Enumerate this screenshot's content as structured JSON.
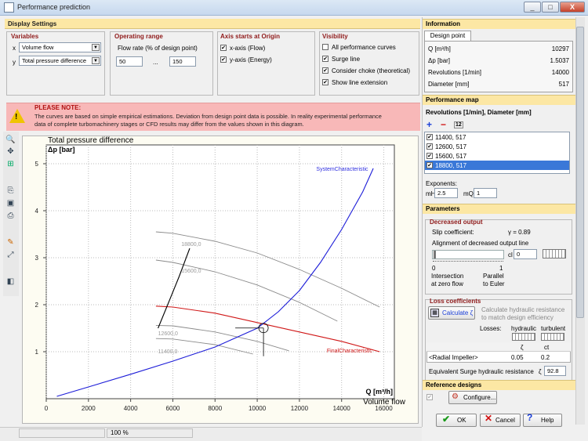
{
  "window": {
    "title": "Performance prediction",
    "min": "_",
    "max": "□",
    "close": "X"
  },
  "display_settings": {
    "header": "Display Settings",
    "variables": {
      "title": "Variables",
      "x_axis": "x",
      "x_value": "Volume flow",
      "y_axis": "y",
      "y_value": "Total pressure difference"
    },
    "operating_range": {
      "title": "Operating range",
      "label": "Flow rate (% of design point)",
      "min": "50",
      "sep": "...",
      "max": "150"
    },
    "axis_origin": {
      "title": "Axis starts at Origin",
      "x_label": "x-axis (Flow)",
      "y_label": "y-axis (Energy)"
    },
    "visibility": {
      "title": "Visibility",
      "items": [
        {
          "label": "All performance curves",
          "checked": false
        },
        {
          "label": "Surge line",
          "checked": true
        },
        {
          "label": "Consider choke (theoretical)",
          "checked": true
        },
        {
          "label": "Show line extension",
          "checked": true
        }
      ]
    }
  },
  "note": {
    "title": "PLEASE NOTE:",
    "line1": "The curves are based on simple empirical estimations. Deviation from design point data is possible. In reality experimental performance",
    "line2": "data of complete turbomachinery stages or CFD results may differ from the values shown in this diagram."
  },
  "chart_data": {
    "type": "line",
    "ylabel_line1": "Total pressure difference",
    "ylabel_line2": "Δp [bar]",
    "xlabel_line1": "Q [m³/h]",
    "xlabel_line2": "Volume flow",
    "xlim": [
      0,
      16500
    ],
    "ylim": [
      0,
      5.4
    ],
    "xticks": [
      0,
      2000,
      4000,
      6000,
      8000,
      10000,
      12000,
      14000,
      16000
    ],
    "yticks": [
      1,
      2,
      3,
      4,
      5
    ],
    "series": [
      {
        "name": "18800,0",
        "color": "#8a8a8a",
        "x": [
          5200,
          6000,
          8000,
          10000,
          12000,
          14000,
          15800
        ],
        "y": [
          3.55,
          3.52,
          3.35,
          3.1,
          2.75,
          2.35,
          1.95
        ]
      },
      {
        "name": "15600,0",
        "color": "#8a8a8a",
        "x": [
          5200,
          6000,
          8000,
          10000,
          12000,
          13800
        ],
        "y": [
          2.95,
          2.9,
          2.7,
          2.42,
          2.05,
          1.65
        ]
      },
      {
        "name": "FinalCharacteristic",
        "color": "#d01818",
        "x": [
          5200,
          6000,
          8000,
          10000,
          12000,
          14000,
          15800
        ],
        "y": [
          1.97,
          1.95,
          1.82,
          1.62,
          1.42,
          1.22,
          1.0
        ]
      },
      {
        "name": "12600,0",
        "color": "#8a8a8a",
        "x": [
          5200,
          6000,
          8000,
          10000,
          11500
        ],
        "y": [
          1.56,
          1.55,
          1.42,
          1.22,
          1.02
        ]
      },
      {
        "name": "11400,0",
        "color": "#8a8a8a",
        "x": [
          5200,
          6000,
          8000,
          9800
        ],
        "y": [
          1.28,
          1.27,
          1.15,
          0.95
        ]
      },
      {
        "name": "SystemCharacteristic",
        "color": "#1c1cd8",
        "x": [
          500,
          2000,
          4000,
          6000,
          8000,
          10000,
          11000,
          12000,
          13000,
          14000,
          15000,
          15500
        ],
        "y": [
          0.05,
          0.25,
          0.52,
          0.8,
          1.1,
          1.5,
          1.85,
          2.3,
          2.9,
          3.6,
          4.4,
          4.9
        ]
      },
      {
        "name": "",
        "color": "#000000",
        "x": [
          5300,
          5800,
          6300,
          6800
        ],
        "y": [
          1.5,
          2.05,
          2.6,
          3.2
        ]
      }
    ],
    "design_point": {
      "x": 10297,
      "y": 1.5037
    },
    "curve_labels": [
      {
        "text": "18800,0",
        "x": 6400,
        "y": 3.25,
        "color": "#9a9a9a"
      },
      {
        "text": "15600,0",
        "x": 6400,
        "y": 2.68,
        "color": "#9a9a9a"
      },
      {
        "text": "12600,0",
        "x": 5300,
        "y": 1.35,
        "color": "#9a9a9a"
      },
      {
        "text": "11400,0",
        "x": 5300,
        "y": 0.97,
        "color": "#9a9a9a"
      },
      {
        "text": "FinalCharacteristic",
        "x": 13300,
        "y": 0.98,
        "color": "#d01818"
      },
      {
        "text": "SystemCharacteristic",
        "x": 12800,
        "y": 4.85,
        "color": "#3030e0"
      }
    ]
  },
  "statusbar": {
    "zoom": "100 %"
  },
  "information": {
    "header": "Information",
    "tab": "Design point",
    "rows": [
      {
        "label": "Q [m³/h]",
        "value": "10297"
      },
      {
        "label": "Δp [bar]",
        "value": "1.5037"
      },
      {
        "label": "Revolutions [1/min]",
        "value": "14000"
      },
      {
        "label": "Diameter [mm]",
        "value": "517"
      }
    ]
  },
  "performance_map": {
    "header": "Performance map",
    "subtitle": "Revolutions [1/min], Diameter [mm]",
    "items": [
      "11400, 517",
      "12600, 517",
      "15600, 517",
      "18800, 517"
    ],
    "exponents_label": "Exponents:",
    "mH_label": "mH",
    "mH": "2.5",
    "mQ_label": "mQ",
    "mQ": "1"
  },
  "parameters": {
    "header": "Parameters",
    "decreased_output": {
      "title": "Decreased output",
      "slip_label": "Slip coefficient:",
      "slip_value": "γ = 0.89",
      "alignment_label": "Alignment of decreased output line",
      "cl_label": "cl",
      "cl_value": "0",
      "tick0": "0",
      "tick1": "1",
      "left_caption1": "Intersection",
      "left_caption2": "at zero flow",
      "right_caption1": "Parallel",
      "right_caption2": "to Euler"
    },
    "loss": {
      "title": "Loss coefficients",
      "calc_button": "Calculate ζ",
      "calc_text1": "Calculate hydraulic resistance",
      "calc_text2": "to match design efficiency",
      "losses_label": "Losses:",
      "col1": "hydraulic",
      "col2": "turbulent",
      "col1_sym": "ζ",
      "col2_sym": "ct",
      "row_label": "<Radial Impeller>",
      "row_v1": "0.05",
      "row_v2": "0.2",
      "surge_label": "Equivalent Surge hydraulic resistance",
      "surge_sym": "ζ",
      "surge_value": "92.8"
    }
  },
  "reference_designs": {
    "header": "Reference designs",
    "configure": "Configure..."
  },
  "buttons": {
    "ok": "OK",
    "cancel": "Cancel",
    "help": "Help"
  }
}
